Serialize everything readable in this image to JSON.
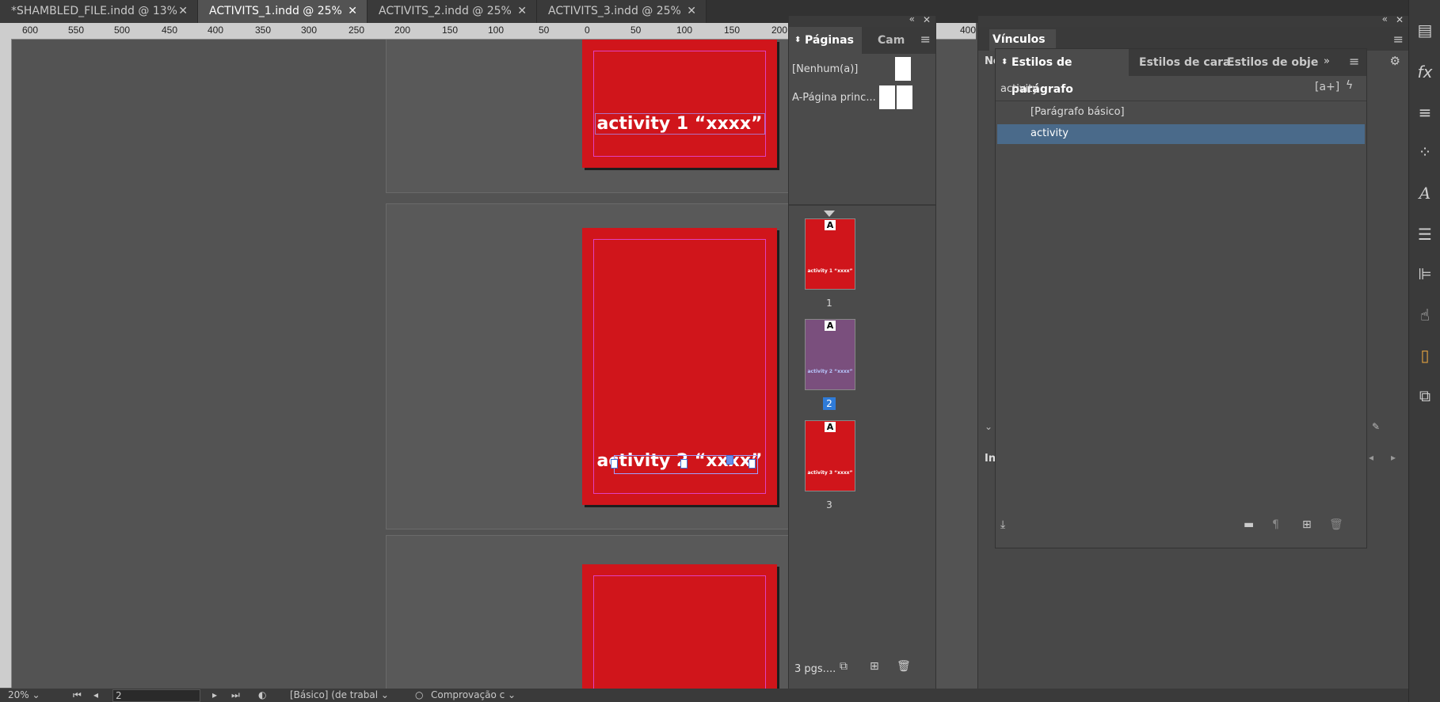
{
  "tabs": [
    {
      "label": "*SHAMBLED_FILE.indd @ 13%",
      "close": "✕"
    },
    {
      "label": "ACTIVITS_1.indd @ 25%",
      "close": "✕"
    },
    {
      "label": "ACTIVITS_2.indd @ 25%",
      "close": "✕"
    },
    {
      "label": "ACTIVITS_3.indd @ 25%",
      "close": "✕"
    }
  ],
  "ruler": {
    "h_labels": [
      "600",
      "550",
      "500",
      "450",
      "400",
      "350",
      "300",
      "250",
      "200",
      "150",
      "100",
      "50",
      "0",
      "50",
      "100",
      "150",
      "200",
      "400"
    ]
  },
  "canvas": {
    "page1_text": "activity 1 “xxxx”",
    "page2_text": "activity 2 “xxxx”"
  },
  "pages_panel": {
    "tab_pages": "Páginas",
    "tab_cam": "Cam",
    "master_none": "[Nenhum(a)]",
    "master_a": "A-Página princ...",
    "thumbs": [
      {
        "num": "1",
        "text": "activity 1 “xxxx”",
        "badge": "A",
        "color": "#d0151b"
      },
      {
        "num": "2",
        "text": "activity 2 “xxxx”",
        "badge": "A",
        "color": "#7a4f7d"
      },
      {
        "num": "3",
        "text": "activity 3 “xxxx”",
        "badge": "A",
        "color": "#d0151b"
      }
    ],
    "footer": "3 pgs...."
  },
  "links_panel": {
    "title": "Vínculos",
    "left_cut_label": "No",
    "left_cut_label2": "In"
  },
  "para_panel": {
    "tab_para": "Estilos de parágrafo",
    "tab_char": "Estilos de cara",
    "tab_obj": "Estilos de obje",
    "search_value": "activity",
    "styles": [
      {
        "label": "[Parágrafo básico]",
        "selected": false
      },
      {
        "label": "activity",
        "selected": true
      }
    ]
  },
  "status": {
    "zoom": "20%",
    "page": "2",
    "work": "[Básico] (de trabal",
    "preflight": "Comprovação c"
  },
  "colors": {
    "page_red": "#d0151b",
    "selected_row": "#4a6a8a",
    "accent_blue": "#2f7bd8"
  }
}
